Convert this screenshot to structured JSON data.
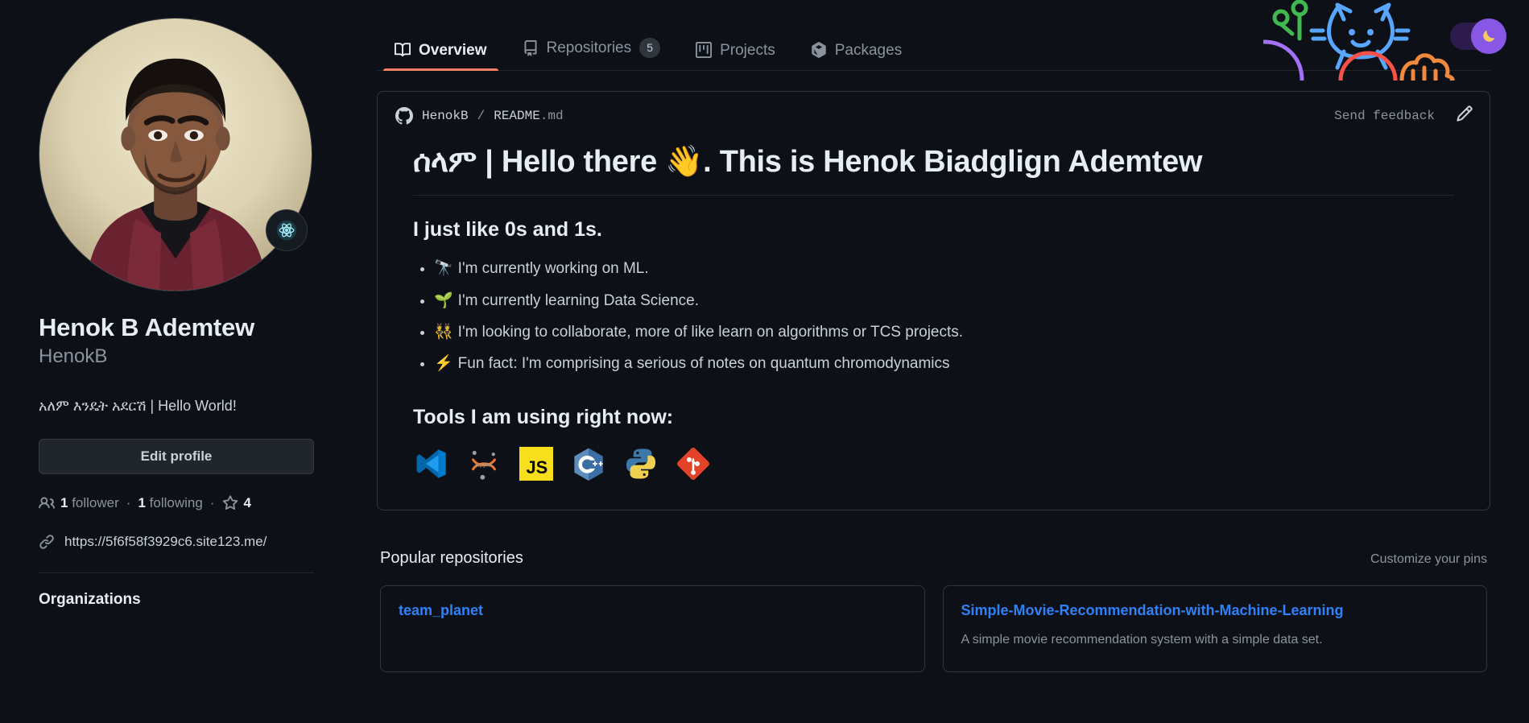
{
  "theme": {
    "accent_tab_underline": "#f78166",
    "link_blue": "#2f81f7",
    "bg": "#0d1117",
    "border": "#30363d",
    "toggle_purple": "#8957e5"
  },
  "nav": {
    "tabs": [
      {
        "label": "Overview",
        "icon": "book-icon",
        "counter": null,
        "active": true
      },
      {
        "label": "Repositories",
        "icon": "repo-icon",
        "counter": "5",
        "active": false
      },
      {
        "label": "Projects",
        "icon": "project-icon",
        "counter": null,
        "active": false
      },
      {
        "label": "Packages",
        "icon": "package-icon",
        "counter": null,
        "active": false
      }
    ]
  },
  "theme_toggle": {
    "icon": "moon-icon",
    "state": "dark"
  },
  "profile": {
    "avatar_alt": "Henok B Ademtew avatar",
    "status_emoji": "atom-icon",
    "name": "Henok B Ademtew",
    "login": "HenokB",
    "bio": "አለም እንዴት አደርሽ | Hello World!",
    "edit_button": "Edit profile",
    "followers_count": "1",
    "followers_label": "follower",
    "following_count": "1",
    "following_label": "following",
    "stars_count": "4",
    "separator": "·",
    "website": "https://5f6f58f3929c6.site123.me/",
    "organizations_title": "Organizations"
  },
  "readme": {
    "owner": "HenokB",
    "slash": "/",
    "file": "README",
    "file_ext": ".md",
    "send_feedback": "Send  feedback",
    "edit_icon": "pencil-icon",
    "heading": "ሰላም | Hello there 👋. This is Henok Biadglign Ademtew",
    "subheading": "I just like 0s and 1s.",
    "bullets": [
      {
        "emoji": "🔭",
        "text": "I'm currently working on ML."
      },
      {
        "emoji": "🌱",
        "text": "I'm currently learning Data Science."
      },
      {
        "emoji": "👯",
        "text": "I'm looking to collaborate, more of like learn on algorithms or TCS projects."
      },
      {
        "emoji": "⚡",
        "text": "Fun fact: I'm comprising a serious of notes on quantum chromodynamics"
      }
    ],
    "tools_title": "Tools I am using right now:",
    "tools": [
      {
        "name": "vscode-icon",
        "label": "Visual Studio Code"
      },
      {
        "name": "jupyter-icon",
        "label": "Jupyter"
      },
      {
        "name": "javascript-icon",
        "label": "JavaScript"
      },
      {
        "name": "cplusplus-icon",
        "label": "C++"
      },
      {
        "name": "python-icon",
        "label": "Python"
      },
      {
        "name": "git-icon",
        "label": "Git"
      }
    ]
  },
  "popular": {
    "title": "Popular repositories",
    "customize": "Customize your pins",
    "repos": [
      {
        "name": "team_planet",
        "desc": ""
      },
      {
        "name": "Simple-Movie-Recommendation-with-Machine-Learning",
        "desc": "A simple movie recommendation system with a simple data set."
      }
    ]
  }
}
